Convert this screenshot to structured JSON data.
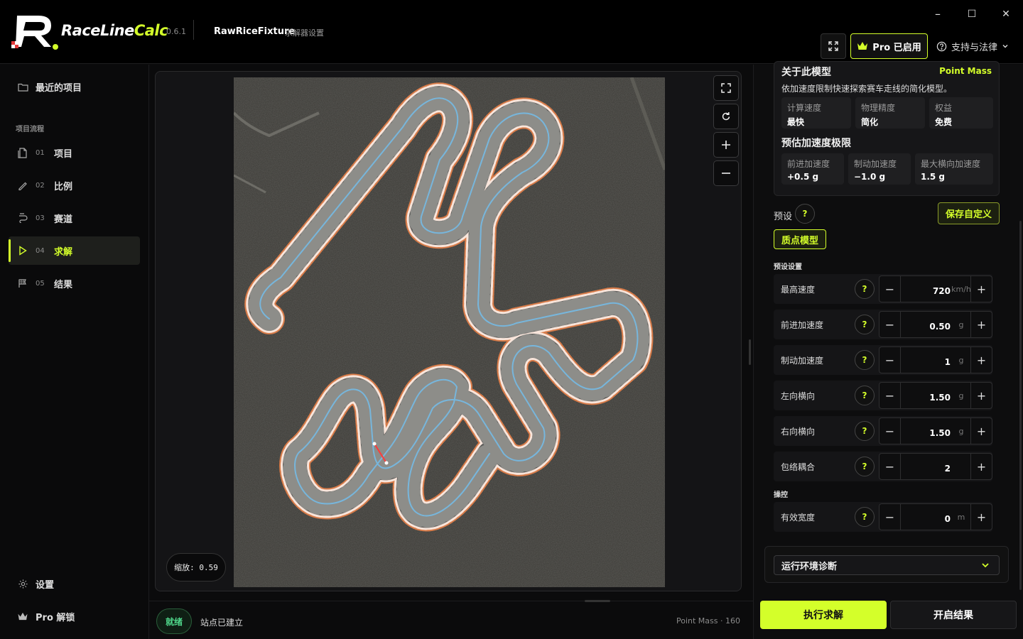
{
  "app": {
    "name_prefix": "RaceLine",
    "name_suffix": "Calc",
    "version": "0.6.1",
    "project": "RawRiceFixture",
    "subtitle": "求解器设置"
  },
  "window": {
    "minimize": "–",
    "maximize": "☐",
    "close": "✕"
  },
  "header": {
    "pro_label": "Pro 已启用",
    "support_label": "支持与法律"
  },
  "sidebar": {
    "recent": "最近的项目",
    "section": "项目流程",
    "items": [
      {
        "num": "01",
        "label": "项目"
      },
      {
        "num": "02",
        "label": "比例"
      },
      {
        "num": "03",
        "label": "赛道"
      },
      {
        "num": "04",
        "label": "求解"
      },
      {
        "num": "05",
        "label": "结果"
      }
    ],
    "settings": "设置",
    "pro_unlock": "Pro 解锁"
  },
  "canvas": {
    "zoom_label": "缩放: 0.59"
  },
  "status": {
    "badge": "就绪",
    "text": "站点已建立",
    "right": "Point Mass · 160"
  },
  "about": {
    "title": "关于此模型",
    "badge": "Point Mass",
    "desc": "依加速度限制快速探索赛车走线的简化模型。",
    "stats": [
      {
        "k": "计算速度",
        "v": "最快"
      },
      {
        "k": "物理精度",
        "v": "简化"
      },
      {
        "k": "权益",
        "v": "免费"
      }
    ],
    "acc_heading": "预估加速度极限",
    "acc": [
      {
        "k": "前进加速度",
        "v": "+0.5 g"
      },
      {
        "k": "制动加速度",
        "v": "−1.0 g"
      },
      {
        "k": "最大横向加速度",
        "v": "1.5 g"
      }
    ]
  },
  "preset": {
    "label": "预设",
    "help": "?",
    "save": "保存自定义",
    "chip": "质点模型"
  },
  "params": {
    "preset_section": "预设设置",
    "control_section": "操控",
    "rows": [
      {
        "label": "最高速度",
        "value": "720",
        "unit": "km/h"
      },
      {
        "label": "前进加速度",
        "value": "0.50",
        "unit": "g"
      },
      {
        "label": "制动加速度",
        "value": "1",
        "unit": "g"
      },
      {
        "label": "左向横向",
        "value": "1.50",
        "unit": "g"
      },
      {
        "label": "右向横向",
        "value": "1.50",
        "unit": "g"
      },
      {
        "label": "包络耦合",
        "value": "2",
        "unit": ""
      }
    ],
    "control_rows": [
      {
        "label": "有效宽度",
        "value": "0",
        "unit": "m"
      }
    ]
  },
  "diagnostics": {
    "label": "运行环境诊断"
  },
  "actions": {
    "run": "执行求解",
    "results": "开启结果"
  },
  "colors": {
    "accent": "#d4ff2a",
    "ready": "#4fd68a",
    "track_edge": "#e8824a",
    "raceline": "#6ec8ff"
  }
}
